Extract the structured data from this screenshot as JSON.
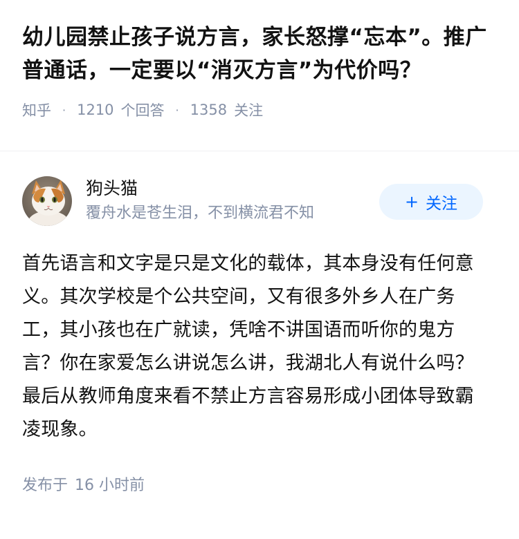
{
  "question": {
    "title": "幼儿园禁止孩子说方言，家长怒撑“忘本”。推广普通话，一定要以“消灭方言”为代价吗？",
    "source": "知乎",
    "separator": "·",
    "answer_count": "1210",
    "answer_label": "个回答",
    "follow_count": "1358",
    "follow_label": "关注"
  },
  "answer": {
    "author": {
      "name": "狗头猫",
      "bio": "覆舟水是苍生泪，不到横流君不知",
      "avatar_icon": "cat-avatar-icon"
    },
    "follow_button": {
      "icon": "+",
      "label": "关注"
    },
    "content": "首先语言和文字是只是文化的载体，其本身没有任何意义。其次学校是个公共空间，又有很多外乡人在广务工，其小孩也在广就读，凭啥不讲国语而听你的鬼方言？你在家爱怎么讲说怎么讲，我湖北人有说什么吗？最后从教师角度来看不禁止方言容易形成小团体导致霸凌现象。",
    "published_label": "发布于",
    "published_time": "16 小时前"
  },
  "colors": {
    "text_primary": "#121212",
    "text_secondary": "#8590a6",
    "accent": "#0066ff",
    "follow_bg": "#ebf5ff"
  }
}
